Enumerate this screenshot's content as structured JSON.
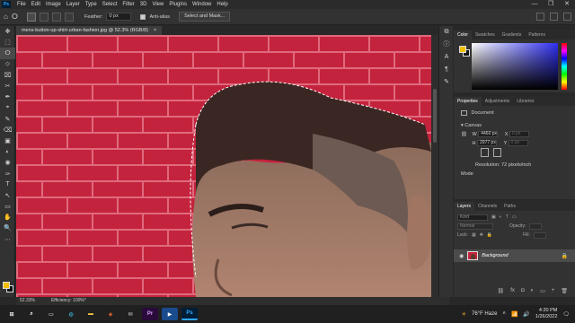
{
  "app": {
    "logo_text": "Ps"
  },
  "menu": [
    "File",
    "Edit",
    "Image",
    "Layer",
    "Type",
    "Select",
    "Filter",
    "3D",
    "View",
    "Plugins",
    "Window",
    "Help"
  ],
  "window_controls": [
    "—",
    "❐",
    "✕"
  ],
  "options_bar": {
    "feather_label": "Feather:",
    "feather_value": "0 px",
    "antialias_label": "Anti-alias",
    "select_mask_label": "Select and Mask..."
  },
  "document": {
    "tab_title": "mens-button-up-shirt-urban-fashion.jpg @ 52.3% (RGB/8)",
    "tab_close": "×"
  },
  "status": {
    "zoom": "52.33%",
    "efficiency": "Efficiency: 100%*"
  },
  "tools": [
    "✥",
    "⬚",
    "ⵔ",
    "⬦",
    "⌧",
    "✂",
    "✒",
    "⌖",
    "✎",
    "⌫",
    "▣",
    "◐",
    "◉",
    "✑",
    "T",
    "↖",
    "▭",
    "✋",
    "🔍",
    "⋯"
  ],
  "colors": {
    "foreground": "#f0c000",
    "background": "#111111",
    "brick": "#c4233d",
    "accent": "#31a8ff"
  },
  "color_panel": {
    "tabs": [
      "Color",
      "Swatches",
      "Gradients",
      "Patterns"
    ]
  },
  "properties_panel": {
    "tabs": [
      "Properties",
      "Adjustments",
      "Libraries"
    ],
    "doc_label": "Document",
    "canvas_label": "Canvas",
    "w_label": "W",
    "w_value": "4460 px",
    "h_label": "H",
    "h_value": "2977 px",
    "x_label": "X",
    "x_value": "0 px",
    "y_label": "Y",
    "y_value": "0 px",
    "resolution": "Resolution: 72 pixels/inch",
    "mode_label": "Mode"
  },
  "layers_panel": {
    "tabs": [
      "Layers",
      "Channels",
      "Paths"
    ],
    "search_placeholder": "Kind",
    "blend_mode": "Normal",
    "opacity_label": "Opacity:",
    "lock_label": "Lock:",
    "fill_label": "Fill:",
    "layer_name": "Background"
  },
  "taskbar": {
    "search_glyph": "⌕",
    "weather": "76°F Haze",
    "time": "4:20 PM",
    "date": "1/26/2022",
    "apps": [
      {
        "label": "⊞",
        "color": "#ffffff",
        "bg": "transparent"
      },
      {
        "label": "◯",
        "color": "#ffffff",
        "bg": "transparent"
      },
      {
        "label": "▭",
        "color": "#ffffff",
        "bg": "transparent"
      },
      {
        "label": "◍",
        "color": "#3ec7f0",
        "bg": "transparent"
      },
      {
        "label": "▬",
        "color": "#f5c242",
        "bg": "transparent"
      },
      {
        "label": "◈",
        "color": "#ff6a2c",
        "bg": "transparent"
      },
      {
        "label": "✉",
        "color": "#cfcfcf",
        "bg": "transparent"
      },
      {
        "label": "Pr",
        "color": "#d8a0ff",
        "bg": "#2a0a3a"
      },
      {
        "label": "▶",
        "color": "#ffffff",
        "bg": "#1a4b8c"
      },
      {
        "label": "Ps",
        "color": "#31a8ff",
        "bg": "#001e36"
      }
    ]
  }
}
